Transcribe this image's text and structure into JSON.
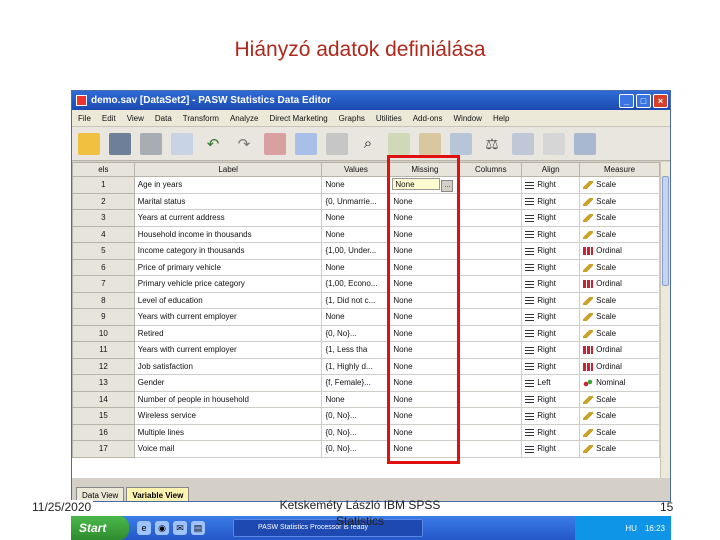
{
  "slide": {
    "title": "Hiányzó adatok definiálása",
    "footer_date": "11/25/2020",
    "footer_center": "Ketskeméty László IBM SPSS Statistics",
    "page_number": "15"
  },
  "window": {
    "title": "demo.sav [DataSet2] - PASW Statistics Data Editor"
  },
  "menu": [
    "File",
    "Edit",
    "View",
    "Data",
    "Transform",
    "Analyze",
    "Direct Marketing",
    "Graphs",
    "Utilities",
    "Add-ons",
    "Window",
    "Help"
  ],
  "columns": [
    "Label",
    "Values",
    "Missing",
    "Columns",
    "Align",
    "Measure"
  ],
  "rows": [
    {
      "n": "1",
      "label": "Age in years",
      "values": "None",
      "missing": "None",
      "align": "Right",
      "measure": "Scale",
      "m": "scale"
    },
    {
      "n": "2",
      "label": "Marital status",
      "values": "{0, Unmarrie...",
      "missing": "None",
      "align": "Right",
      "measure": "Scale",
      "m": "scale"
    },
    {
      "n": "3",
      "label": "Years at current address",
      "values": "None",
      "missing": "None",
      "align": "Right",
      "measure": "Scale",
      "m": "scale"
    },
    {
      "n": "4",
      "label": "Household income in thousands",
      "values": "None",
      "missing": "None",
      "align": "Right",
      "measure": "Scale",
      "m": "scale"
    },
    {
      "n": "5",
      "label": "Income category in thousands",
      "values": "{1,00, Under...",
      "missing": "None",
      "align": "Right",
      "measure": "Ordinal",
      "m": "ordinal"
    },
    {
      "n": "6",
      "label": "Price of primary vehicle",
      "values": "None",
      "missing": "None",
      "align": "Right",
      "measure": "Scale",
      "m": "scale"
    },
    {
      "n": "7",
      "label": "Primary vehicle price category",
      "values": "{1,00, Econo...",
      "missing": "None",
      "align": "Right",
      "measure": "Ordinal",
      "m": "ordinal"
    },
    {
      "n": "8",
      "label": "Level of education",
      "values": "{1, Did not c...",
      "missing": "None",
      "align": "Right",
      "measure": "Scale",
      "m": "scale"
    },
    {
      "n": "9",
      "label": "Years with current employer",
      "values": "None",
      "missing": "None",
      "align": "Right",
      "measure": "Scale",
      "m": "scale"
    },
    {
      "n": "10",
      "label": "Retired",
      "values": "{0, No}...",
      "missing": "None",
      "align": "Right",
      "measure": "Scale",
      "m": "scale"
    },
    {
      "n": "11",
      "label": "Years with current employer",
      "values": "{1, Less tha",
      "missing": "None",
      "align": "Right",
      "measure": "Ordinal",
      "m": "ordinal"
    },
    {
      "n": "12",
      "label": "Job satisfaction",
      "values": "{1, Highly d...",
      "missing": "None",
      "align": "Right",
      "measure": "Ordinal",
      "m": "ordinal"
    },
    {
      "n": "13",
      "label": "Gender",
      "values": "{f, Female}...",
      "missing": "None",
      "align": "Left",
      "measure": "Nominal",
      "m": "nominal"
    },
    {
      "n": "14",
      "label": "Number of people in household",
      "values": "None",
      "missing": "None",
      "align": "Right",
      "measure": "Scale",
      "m": "scale"
    },
    {
      "n": "15",
      "label": "Wireless service",
      "values": "{0, No}...",
      "missing": "None",
      "align": "Right",
      "measure": "Scale",
      "m": "scale"
    },
    {
      "n": "16",
      "label": "Multiple lines",
      "values": "{0, No}...",
      "missing": "None",
      "align": "Right",
      "measure": "Scale",
      "m": "scale"
    },
    {
      "n": "17",
      "label": "Voice mail",
      "values": "{0, No}...",
      "missing": "None",
      "align": "Right",
      "measure": "Scale",
      "m": "scale"
    }
  ],
  "tabs": {
    "data_view": "Data View",
    "variable_view": "Variable View"
  },
  "taskbar": {
    "start": "Start",
    "task": "PASW Statistics Processor is ready",
    "tray_lang": "HU",
    "clock": "16:23"
  }
}
